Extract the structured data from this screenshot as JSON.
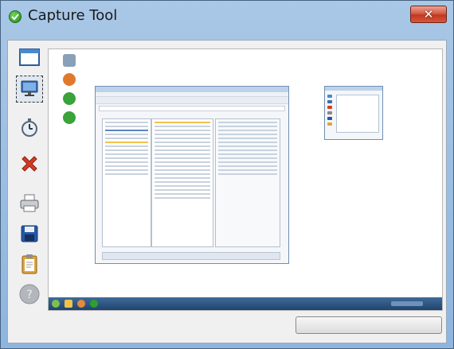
{
  "window": {
    "title": "Capture Tool",
    "close_label": "✕"
  },
  "toolbar": {
    "items": [
      {
        "name": "window-capture-icon"
      },
      {
        "name": "screen-capture-icon",
        "selected": true
      },
      {
        "name": "timer-icon"
      },
      {
        "name": "cancel-icon"
      },
      {
        "name": "print-icon"
      },
      {
        "name": "save-icon"
      },
      {
        "name": "clipboard-icon"
      },
      {
        "name": "help-icon",
        "disabled": true
      }
    ]
  },
  "preview": {
    "desktop_icons": [
      {
        "name": "recycle-bin-icon",
        "color": "#8aa0b8"
      },
      {
        "name": "firefox-icon",
        "color": "#e07a2b"
      },
      {
        "name": "greenshot-icon",
        "color": "#3aa33a"
      },
      {
        "name": "greenshot-icon-2",
        "color": "#3aa33a"
      }
    ],
    "taskbar_items": [
      {
        "name": "start-orb-icon",
        "color": "#7fbf4f"
      },
      {
        "name": "explorer-task-icon",
        "color": "#f0c24a"
      },
      {
        "name": "firefox-task-icon",
        "color": "#e58a3a"
      },
      {
        "name": "capture-task-icon",
        "color": "#2f9f2f"
      }
    ]
  },
  "bottom_button": {
    "label": ""
  }
}
